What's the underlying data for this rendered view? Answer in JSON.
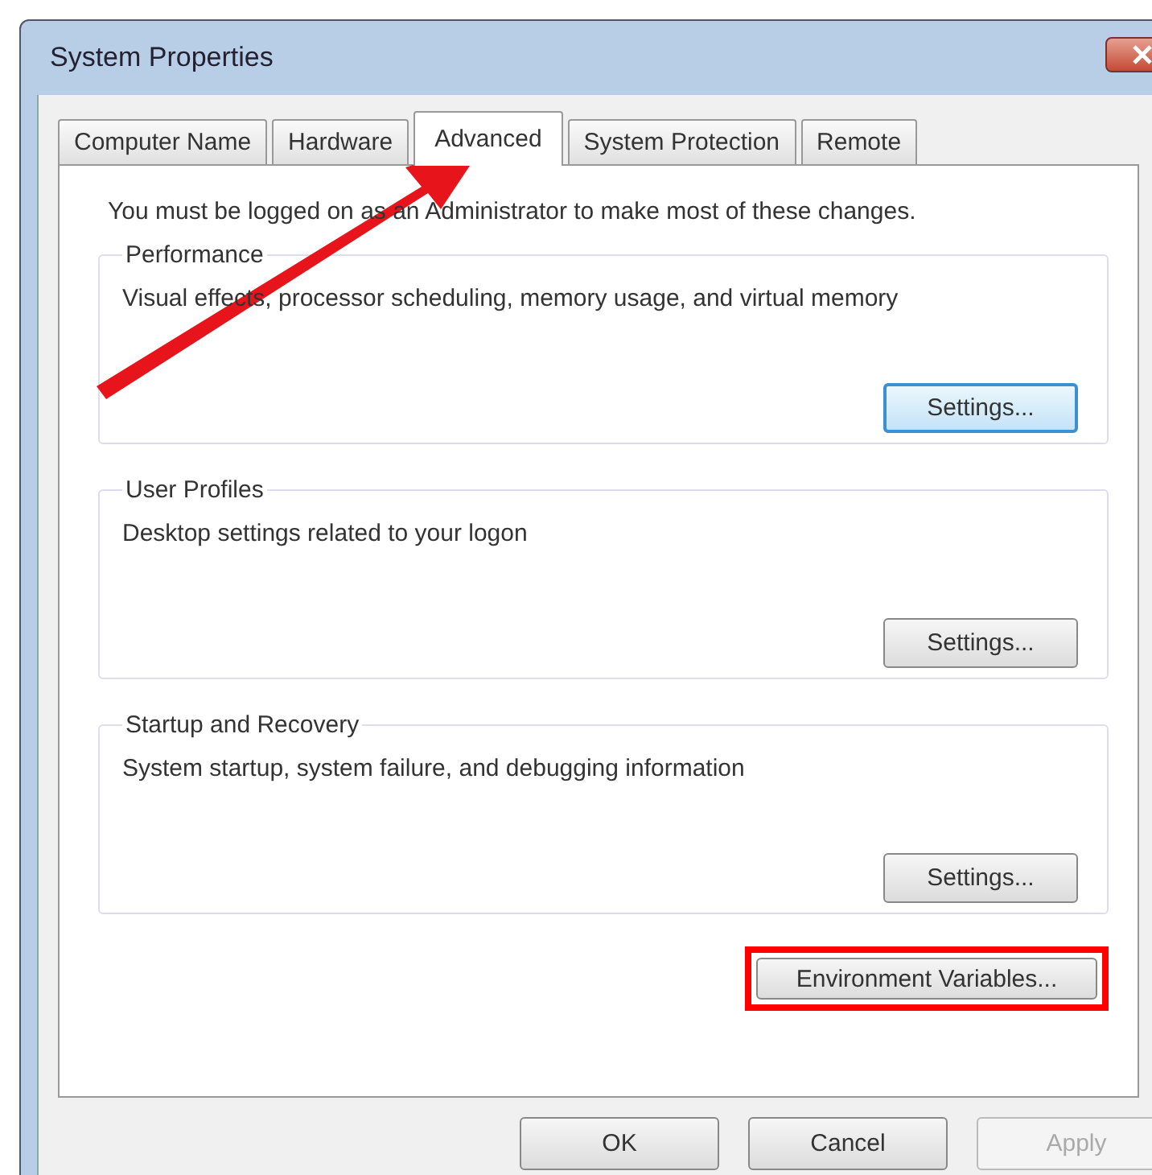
{
  "window": {
    "title": "System Properties"
  },
  "tabs": [
    {
      "label": "Computer Name",
      "selected": false
    },
    {
      "label": "Hardware",
      "selected": false
    },
    {
      "label": "Advanced",
      "selected": true
    },
    {
      "label": "System Protection",
      "selected": false
    },
    {
      "label": "Remote",
      "selected": false
    }
  ],
  "notice": "You must be logged on as an Administrator to make most of these changes.",
  "groups": [
    {
      "title": "Performance",
      "description": "Visual effects, processor scheduling, memory usage, and virtual memory",
      "button": {
        "label": "Settings...",
        "focused": true
      }
    },
    {
      "title": "User Profiles",
      "description": "Desktop settings related to your logon",
      "button": {
        "label": "Settings...",
        "focused": false
      }
    },
    {
      "title": "Startup and Recovery",
      "description": "System startup, system failure, and debugging information",
      "button": {
        "label": "Settings...",
        "focused": false
      }
    }
  ],
  "environment_button": {
    "label": "Environment Variables...",
    "highlighted": true
  },
  "buttons": [
    {
      "label": "OK",
      "disabled": false
    },
    {
      "label": "Cancel",
      "disabled": false
    },
    {
      "label": "Apply",
      "disabled": true
    }
  ]
}
